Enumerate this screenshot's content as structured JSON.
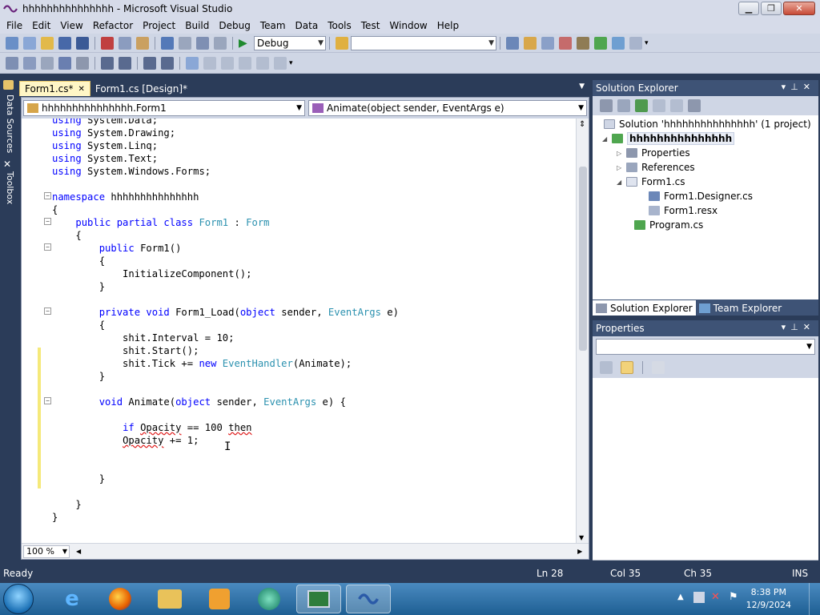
{
  "window": {
    "title": "hhhhhhhhhhhhhhh - Microsoft Visual Studio",
    "min": "▁",
    "max": "❐",
    "close": "✕"
  },
  "menu": [
    "File",
    "Edit",
    "View",
    "Refactor",
    "Project",
    "Build",
    "Debug",
    "Team",
    "Data",
    "Tools",
    "Test",
    "Window",
    "Help"
  ],
  "toolbar": {
    "config": "Debug",
    "find": ""
  },
  "sidebar": {
    "data_sources": "Data Sources",
    "toolbox": "Toolbox"
  },
  "tabs": [
    {
      "label": "Form1.cs*",
      "active": true
    },
    {
      "label": "Form1.cs [Design]*",
      "active": false
    }
  ],
  "nav": {
    "class": "hhhhhhhhhhhhhhh.Form1",
    "member": "Animate(object sender, EventArgs e)"
  },
  "code": [
    "using System.Data;",
    "using System.Drawing;",
    "using System.Linq;",
    "using System.Text;",
    "using System.Windows.Forms;",
    "",
    "namespace hhhhhhhhhhhhhhh",
    "{",
    "    public partial class Form1 : Form",
    "    {",
    "        public Form1()",
    "        {",
    "            InitializeComponent();",
    "        }",
    "",
    "        private void Form1_Load(object sender, EventArgs e)",
    "        {",
    "            shit.Interval = 10;",
    "            shit.Start();",
    "            shit.Tick += new EventHandler(Animate);",
    "        }",
    "",
    "        void Animate(object sender, EventArgs e) {",
    "",
    "            if Opacity == 100 then",
    "            Opacity += 1;",
    "",
    "",
    "        }",
    "",
    "    }",
    "}"
  ],
  "zoom": "100 %",
  "solution_explorer": {
    "title": "Solution Explorer",
    "items": [
      {
        "label": "Solution 'hhhhhhhhhhhhhhh' (1 project)"
      },
      {
        "label": "hhhhhhhhhhhhhhh"
      },
      {
        "label": "Properties"
      },
      {
        "label": "References"
      },
      {
        "label": "Form1.cs"
      },
      {
        "label": "Form1.Designer.cs"
      },
      {
        "label": "Form1.resx"
      },
      {
        "label": "Program.cs"
      }
    ],
    "tab_solution": "Solution Explorer",
    "tab_team": "Team Explorer"
  },
  "properties": {
    "title": "Properties"
  },
  "status": {
    "ready": "Ready",
    "ln": "Ln 28",
    "col": "Col 35",
    "ch": "Ch 35",
    "ins": "INS"
  },
  "clock": {
    "time": "8:38 PM",
    "date": "12/9/2024"
  },
  "colors": {
    "accent": "#2b3c59",
    "tab_active": "#fff6c6",
    "keyword": "#0000ff",
    "type": "#2b91af"
  }
}
